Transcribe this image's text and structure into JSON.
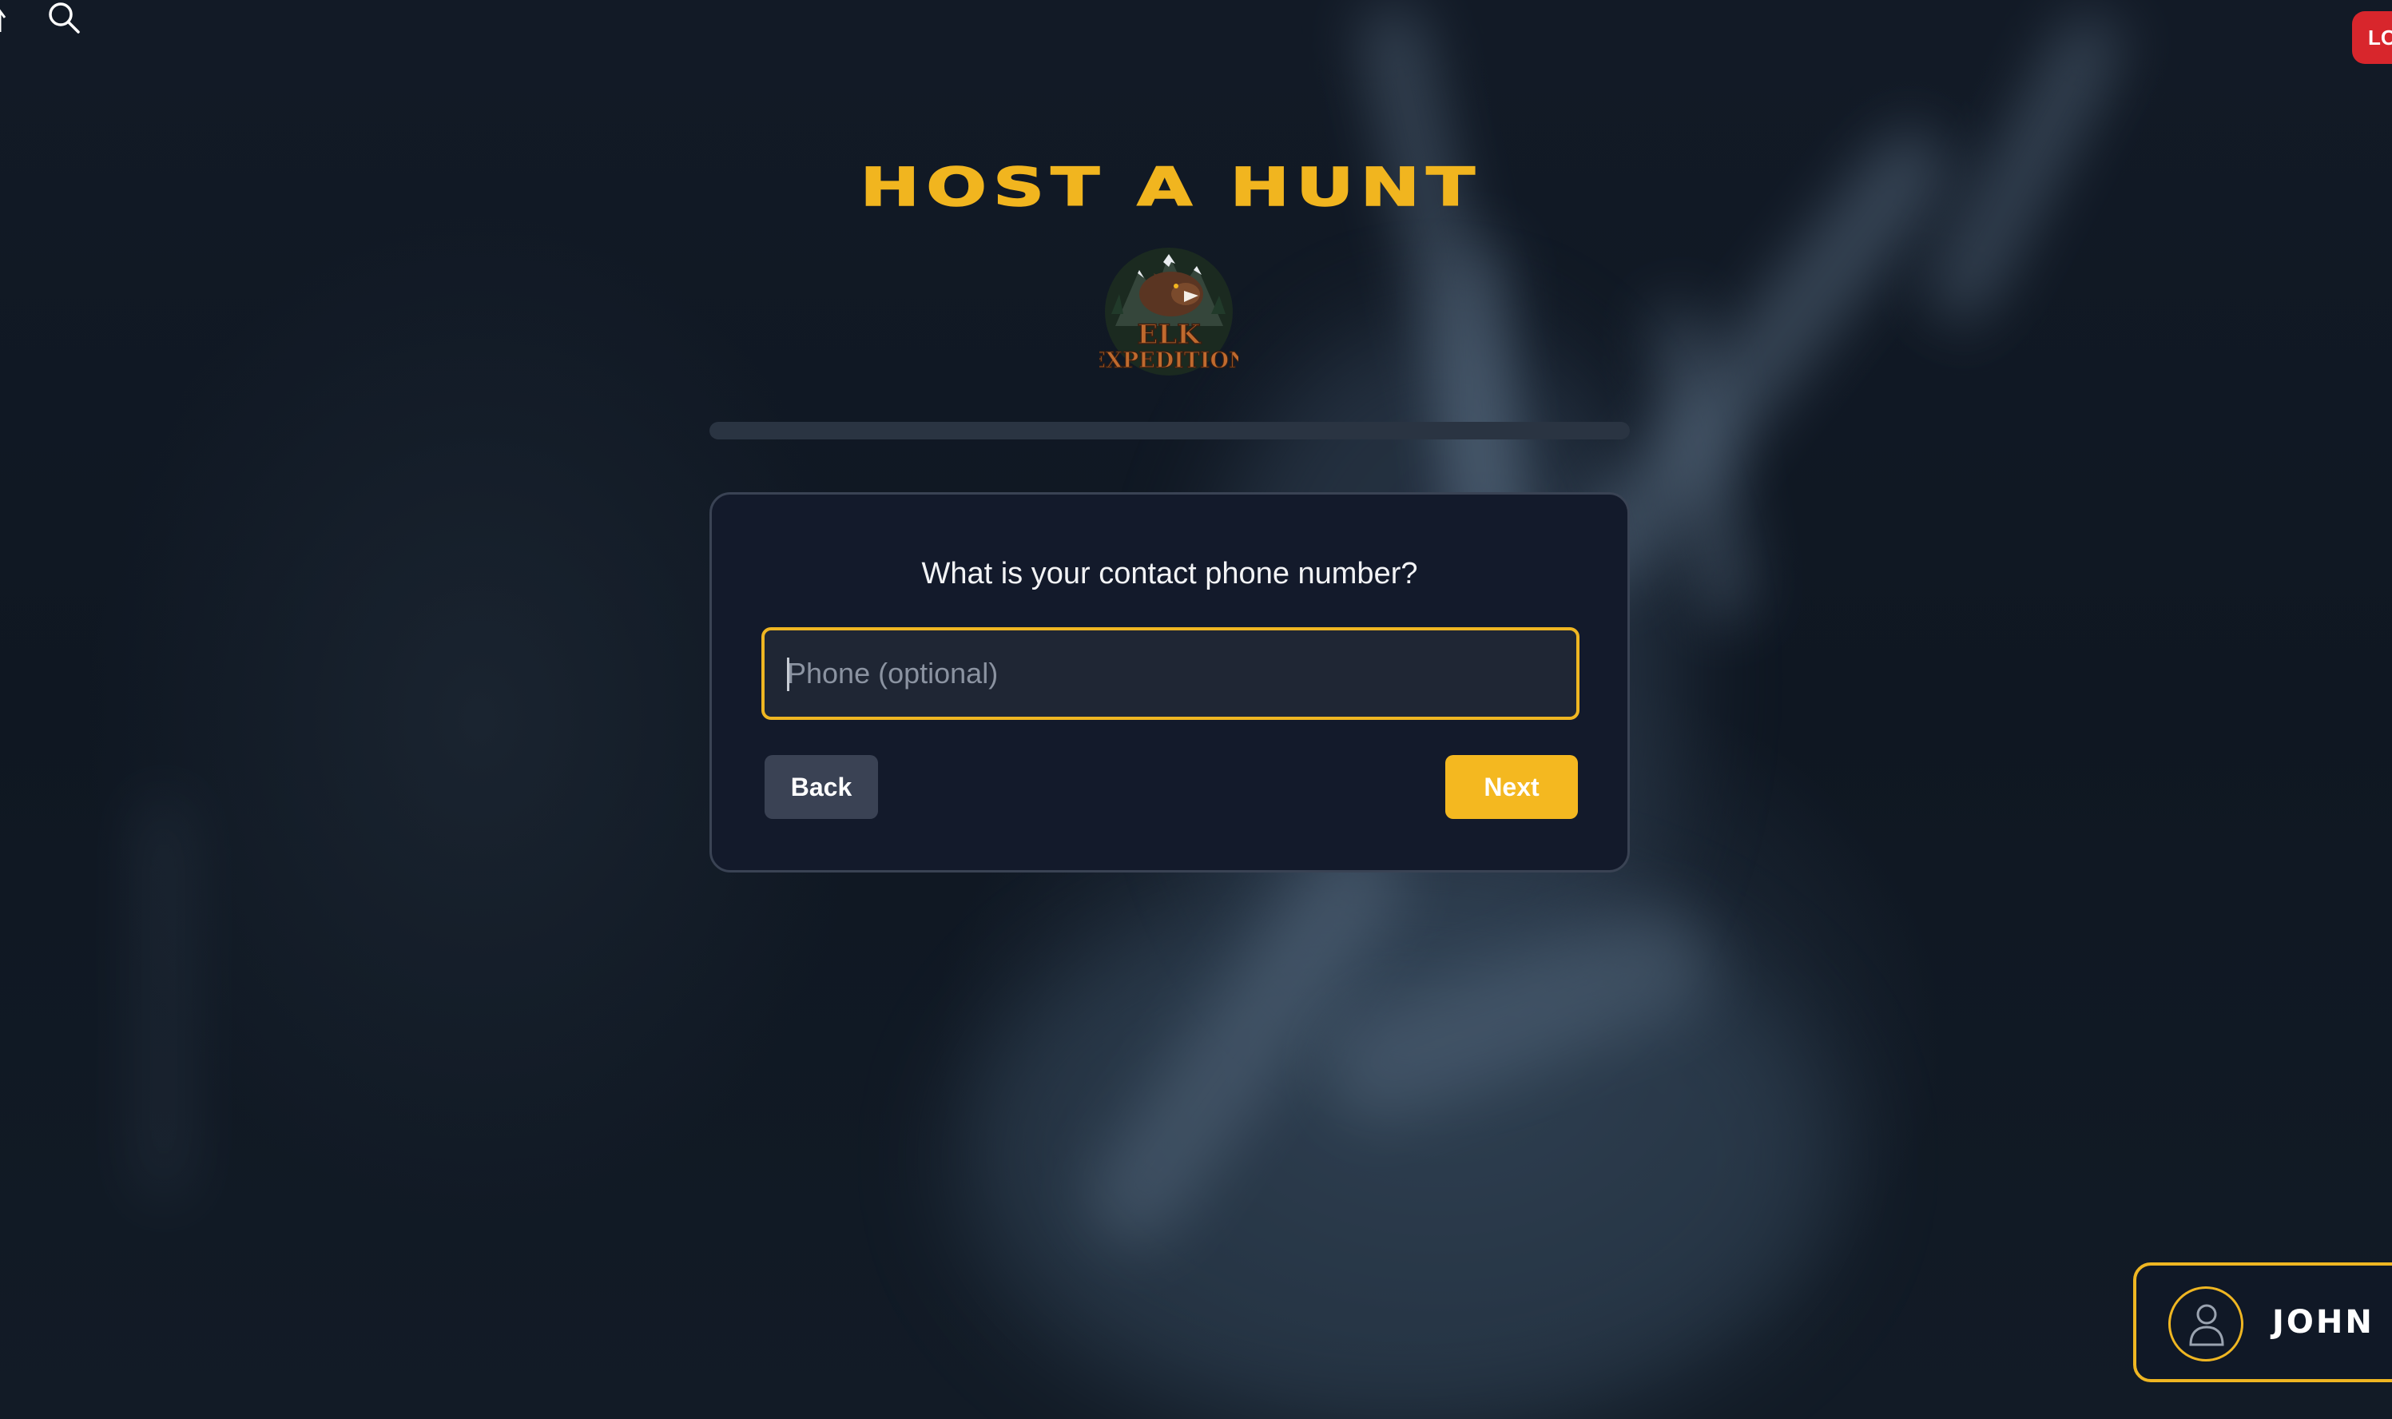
{
  "header": {
    "title": "HOST A HUNT",
    "logo_text_line1": "ELK",
    "logo_text_line2": "EXPEDITION"
  },
  "corner_badge": {
    "label": "LO"
  },
  "progress": {
    "fraction": 0
  },
  "form": {
    "question": "What is your contact phone number?",
    "phone_placeholder": "Phone (optional)",
    "phone_value": "",
    "back_label": "Back",
    "next_label": "Next"
  },
  "user": {
    "name": "JOHN"
  },
  "colors": {
    "accent": "#f1b51f",
    "card_bg": "#131a2b",
    "back_button": "#3a4254",
    "badge_red": "#d8262c"
  },
  "icons": [
    "arrow-up-icon",
    "search-icon",
    "user-icon"
  ]
}
